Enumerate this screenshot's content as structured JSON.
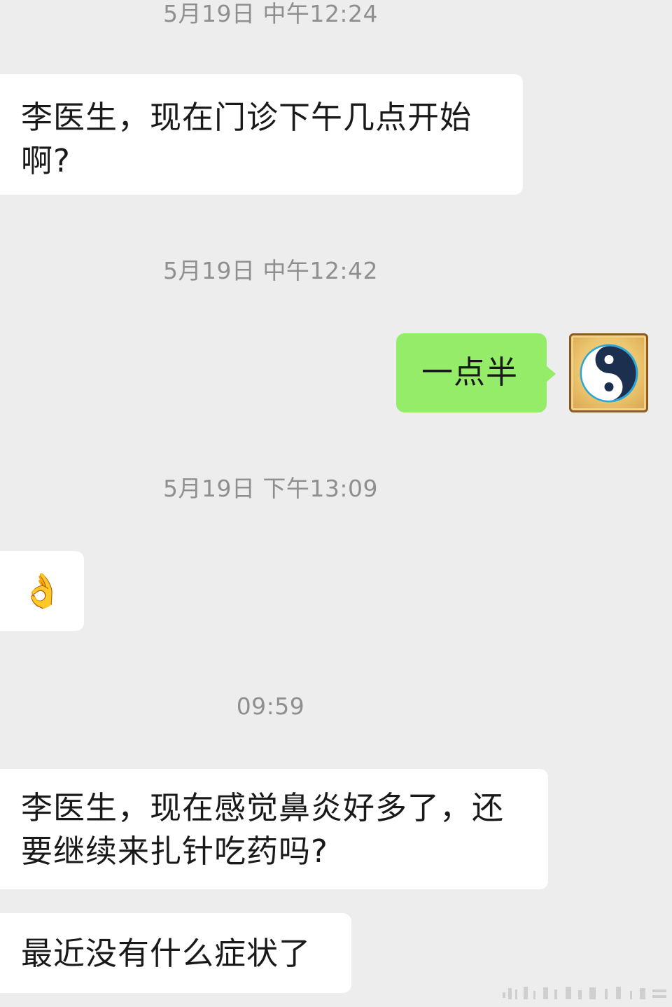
{
  "conversation": {
    "messages": [
      {
        "type": "timestamp",
        "text": "5月19日 中午12:24"
      },
      {
        "type": "received",
        "text_lines": [
          "李医生，现在门诊下午几点开始",
          "啊?"
        ]
      },
      {
        "type": "timestamp",
        "text": "5月19日 中午12:42"
      },
      {
        "type": "sent",
        "text": "一点半",
        "avatar_icon": "yin-yang-icon"
      },
      {
        "type": "timestamp",
        "text": "5月19日 下午13:09"
      },
      {
        "type": "received",
        "text": "👌"
      },
      {
        "type": "timestamp",
        "text": "09:59"
      },
      {
        "type": "received",
        "text_lines": [
          "李医生，现在感觉鼻炎好多了，还",
          "要继续来扎针吃药吗?"
        ]
      },
      {
        "type": "received",
        "text": "最近没有什么症状了"
      }
    ]
  },
  "colors": {
    "background": "#ededed",
    "received_bubble": "#ffffff",
    "sent_bubble": "#95ec69",
    "timestamp_text": "#8f8f8f",
    "message_text": "#191919"
  }
}
